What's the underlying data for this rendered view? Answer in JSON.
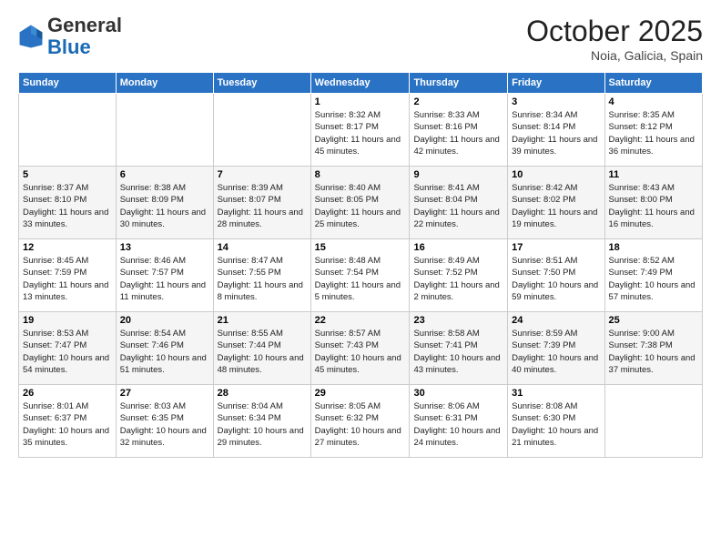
{
  "header": {
    "logo_general": "General",
    "logo_blue": "Blue",
    "month": "October 2025",
    "location": "Noia, Galicia, Spain"
  },
  "days_of_week": [
    "Sunday",
    "Monday",
    "Tuesday",
    "Wednesday",
    "Thursday",
    "Friday",
    "Saturday"
  ],
  "weeks": [
    [
      {
        "day": "",
        "info": ""
      },
      {
        "day": "",
        "info": ""
      },
      {
        "day": "",
        "info": ""
      },
      {
        "day": "1",
        "info": "Sunrise: 8:32 AM\nSunset: 8:17 PM\nDaylight: 11 hours and 45 minutes."
      },
      {
        "day": "2",
        "info": "Sunrise: 8:33 AM\nSunset: 8:16 PM\nDaylight: 11 hours and 42 minutes."
      },
      {
        "day": "3",
        "info": "Sunrise: 8:34 AM\nSunset: 8:14 PM\nDaylight: 11 hours and 39 minutes."
      },
      {
        "day": "4",
        "info": "Sunrise: 8:35 AM\nSunset: 8:12 PM\nDaylight: 11 hours and 36 minutes."
      }
    ],
    [
      {
        "day": "5",
        "info": "Sunrise: 8:37 AM\nSunset: 8:10 PM\nDaylight: 11 hours and 33 minutes."
      },
      {
        "day": "6",
        "info": "Sunrise: 8:38 AM\nSunset: 8:09 PM\nDaylight: 11 hours and 30 minutes."
      },
      {
        "day": "7",
        "info": "Sunrise: 8:39 AM\nSunset: 8:07 PM\nDaylight: 11 hours and 28 minutes."
      },
      {
        "day": "8",
        "info": "Sunrise: 8:40 AM\nSunset: 8:05 PM\nDaylight: 11 hours and 25 minutes."
      },
      {
        "day": "9",
        "info": "Sunrise: 8:41 AM\nSunset: 8:04 PM\nDaylight: 11 hours and 22 minutes."
      },
      {
        "day": "10",
        "info": "Sunrise: 8:42 AM\nSunset: 8:02 PM\nDaylight: 11 hours and 19 minutes."
      },
      {
        "day": "11",
        "info": "Sunrise: 8:43 AM\nSunset: 8:00 PM\nDaylight: 11 hours and 16 minutes."
      }
    ],
    [
      {
        "day": "12",
        "info": "Sunrise: 8:45 AM\nSunset: 7:59 PM\nDaylight: 11 hours and 13 minutes."
      },
      {
        "day": "13",
        "info": "Sunrise: 8:46 AM\nSunset: 7:57 PM\nDaylight: 11 hours and 11 minutes."
      },
      {
        "day": "14",
        "info": "Sunrise: 8:47 AM\nSunset: 7:55 PM\nDaylight: 11 hours and 8 minutes."
      },
      {
        "day": "15",
        "info": "Sunrise: 8:48 AM\nSunset: 7:54 PM\nDaylight: 11 hours and 5 minutes."
      },
      {
        "day": "16",
        "info": "Sunrise: 8:49 AM\nSunset: 7:52 PM\nDaylight: 11 hours and 2 minutes."
      },
      {
        "day": "17",
        "info": "Sunrise: 8:51 AM\nSunset: 7:50 PM\nDaylight: 10 hours and 59 minutes."
      },
      {
        "day": "18",
        "info": "Sunrise: 8:52 AM\nSunset: 7:49 PM\nDaylight: 10 hours and 57 minutes."
      }
    ],
    [
      {
        "day": "19",
        "info": "Sunrise: 8:53 AM\nSunset: 7:47 PM\nDaylight: 10 hours and 54 minutes."
      },
      {
        "day": "20",
        "info": "Sunrise: 8:54 AM\nSunset: 7:46 PM\nDaylight: 10 hours and 51 minutes."
      },
      {
        "day": "21",
        "info": "Sunrise: 8:55 AM\nSunset: 7:44 PM\nDaylight: 10 hours and 48 minutes."
      },
      {
        "day": "22",
        "info": "Sunrise: 8:57 AM\nSunset: 7:43 PM\nDaylight: 10 hours and 45 minutes."
      },
      {
        "day": "23",
        "info": "Sunrise: 8:58 AM\nSunset: 7:41 PM\nDaylight: 10 hours and 43 minutes."
      },
      {
        "day": "24",
        "info": "Sunrise: 8:59 AM\nSunset: 7:39 PM\nDaylight: 10 hours and 40 minutes."
      },
      {
        "day": "25",
        "info": "Sunrise: 9:00 AM\nSunset: 7:38 PM\nDaylight: 10 hours and 37 minutes."
      }
    ],
    [
      {
        "day": "26",
        "info": "Sunrise: 8:01 AM\nSunset: 6:37 PM\nDaylight: 10 hours and 35 minutes."
      },
      {
        "day": "27",
        "info": "Sunrise: 8:03 AM\nSunset: 6:35 PM\nDaylight: 10 hours and 32 minutes."
      },
      {
        "day": "28",
        "info": "Sunrise: 8:04 AM\nSunset: 6:34 PM\nDaylight: 10 hours and 29 minutes."
      },
      {
        "day": "29",
        "info": "Sunrise: 8:05 AM\nSunset: 6:32 PM\nDaylight: 10 hours and 27 minutes."
      },
      {
        "day": "30",
        "info": "Sunrise: 8:06 AM\nSunset: 6:31 PM\nDaylight: 10 hours and 24 minutes."
      },
      {
        "day": "31",
        "info": "Sunrise: 8:08 AM\nSunset: 6:30 PM\nDaylight: 10 hours and 21 minutes."
      },
      {
        "day": "",
        "info": ""
      }
    ]
  ]
}
